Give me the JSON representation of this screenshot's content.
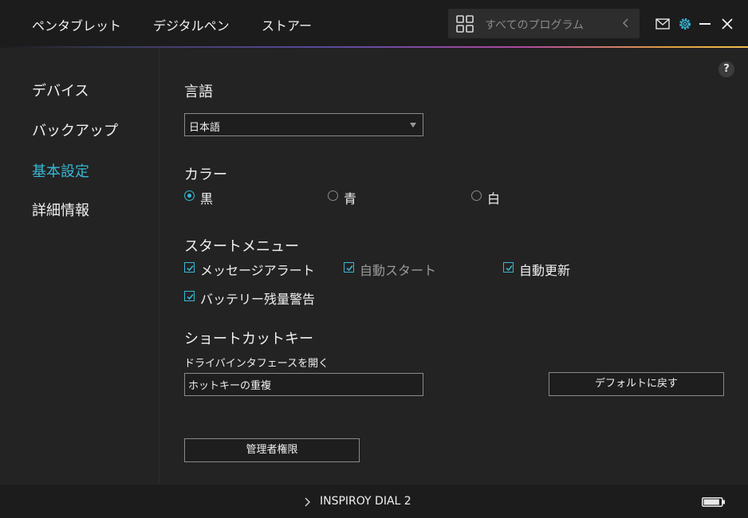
{
  "topnav": {
    "tabs": [
      "ペンタブレット",
      "デジタルペン",
      "ストアー"
    ]
  },
  "search": {
    "placeholder": "すべてのプログラム",
    "icon": "grid-icon"
  },
  "window_controls": {
    "icons": [
      "mail-icon",
      "settings-gear-icon",
      "minimize-icon",
      "close-icon"
    ],
    "accent": "#37b8d6"
  },
  "sidebar": {
    "items": [
      {
        "label": "デバイス",
        "active": false
      },
      {
        "label": "バックアップ",
        "active": false
      },
      {
        "label": "基本設定",
        "active": true
      },
      {
        "label": "詳細情報",
        "active": false
      }
    ]
  },
  "main": {
    "help_label": "?",
    "language": {
      "title": "言語",
      "selected": "日本語"
    },
    "color": {
      "title": "カラー",
      "options": [
        {
          "label": "黒",
          "checked": true
        },
        {
          "label": "青",
          "checked": false
        },
        {
          "label": "白",
          "checked": false
        }
      ]
    },
    "start_menu": {
      "title": "スタートメニュー",
      "options": [
        {
          "label": "メッセージアラート",
          "checked": true,
          "dim": false
        },
        {
          "label": "自動スタート",
          "checked": true,
          "dim": true
        },
        {
          "label": "自動更新",
          "checked": true,
          "dim": false
        },
        {
          "label": "バッテリー残量警告",
          "checked": true,
          "dim": false
        }
      ]
    },
    "shortcut": {
      "title": "ショートカットキー",
      "field_label": "ドライバインタフェースを開く",
      "field_value": "ホットキーの重複",
      "default_button": "デフォルトに戻す"
    },
    "admin_button": "管理者権限"
  },
  "bottombar": {
    "device_name": "INSPIROY DIAL 2",
    "battery_level": 0.9
  }
}
